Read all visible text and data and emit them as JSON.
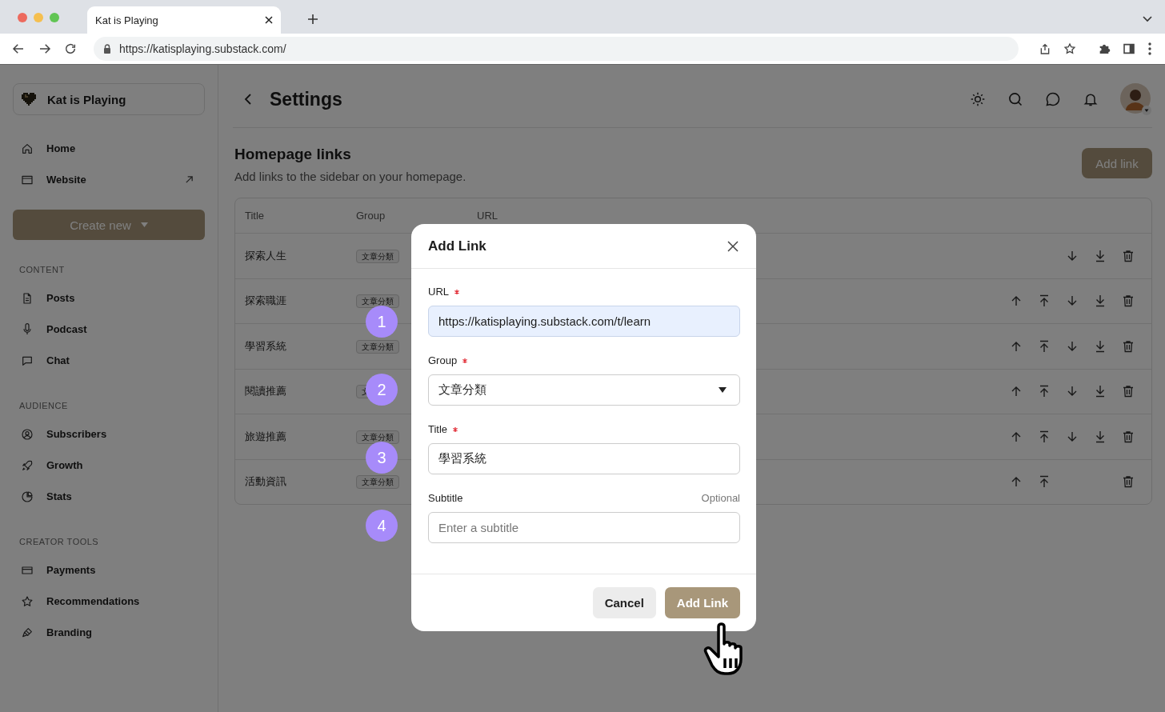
{
  "browser": {
    "tab_title": "Kat is Playing",
    "url": "https://katisplaying.substack.com/"
  },
  "sidebar": {
    "publication": "Kat is Playing",
    "top_items": [
      {
        "label": "Home",
        "external": false
      },
      {
        "label": "Website",
        "external": true
      }
    ],
    "create_button": "Create new",
    "sections": [
      {
        "heading": "CONTENT",
        "items": [
          {
            "label": "Posts"
          },
          {
            "label": "Podcast"
          },
          {
            "label": "Chat"
          }
        ]
      },
      {
        "heading": "AUDIENCE",
        "items": [
          {
            "label": "Subscribers"
          },
          {
            "label": "Growth"
          },
          {
            "label": "Stats"
          }
        ]
      },
      {
        "heading": "CREATOR TOOLS",
        "items": [
          {
            "label": "Payments"
          },
          {
            "label": "Recommendations"
          },
          {
            "label": "Branding"
          }
        ]
      }
    ]
  },
  "header": {
    "title": "Settings"
  },
  "section": {
    "title": "Homepage links",
    "description": "Add links to the sidebar on your homepage.",
    "add_button": "Add link"
  },
  "table": {
    "columns": [
      "Title",
      "Group",
      "URL"
    ],
    "rows": [
      {
        "title": "探索人生",
        "group": "文章分類",
        "can_move_up": false,
        "can_move_down": true
      },
      {
        "title": "探索職涯",
        "group": "文章分類",
        "can_move_up": true,
        "can_move_down": true
      },
      {
        "title": "學習系統",
        "group": "文章分類",
        "can_move_up": true,
        "can_move_down": true
      },
      {
        "title": "閱讀推薦",
        "group": "文",
        "can_move_up": true,
        "can_move_down": true
      },
      {
        "title": "旅遊推薦",
        "group": "文章分類",
        "can_move_up": true,
        "can_move_down": true
      },
      {
        "title": "活動資訊",
        "group": "文章分類",
        "can_move_up": true,
        "can_move_down": false
      }
    ]
  },
  "modal": {
    "title": "Add Link",
    "fields": [
      {
        "kind": "text",
        "label": "URL",
        "required": true,
        "value": "https://katisplaying.substack.com/t/learn",
        "autofilled": true
      },
      {
        "kind": "select",
        "label": "Group",
        "required": true,
        "value": "文章分類"
      },
      {
        "kind": "text",
        "label": "Title",
        "required": true,
        "value": "學習系統",
        "autofilled": false
      },
      {
        "kind": "text",
        "label": "Subtitle",
        "required": false,
        "hint": "Optional",
        "placeholder": "Enter a subtitle",
        "autofilled": false
      }
    ],
    "buttons": [
      {
        "kind": "secondary",
        "label": "Cancel"
      },
      {
        "kind": "primary",
        "label": "Add Link"
      }
    ]
  },
  "step_markers": [
    "1",
    "2",
    "3",
    "4"
  ]
}
